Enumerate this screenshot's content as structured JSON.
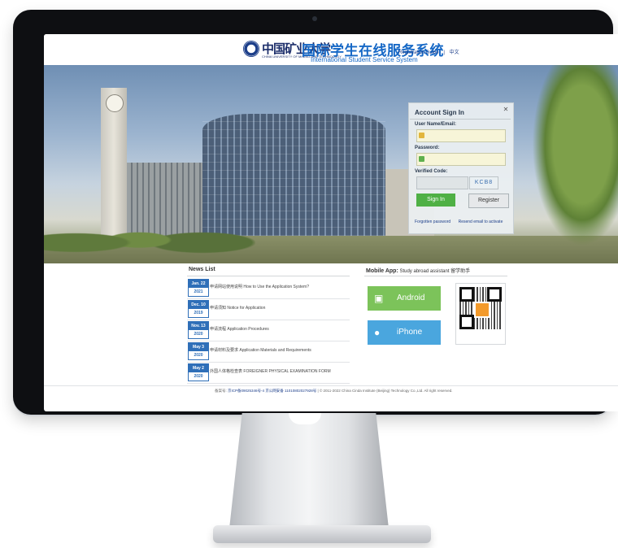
{
  "header": {
    "university_name_cn": "中国矿业大学",
    "university_name_en": "CHINA UNIVERSITY OF MINING AND TECHNOLOGY",
    "site_title_cn": "国际学生在线服务系统",
    "site_title_en": "International Student Service System",
    "links": [
      "Registration Guide",
      "|",
      "中文"
    ]
  },
  "login": {
    "title": "Account Sign In",
    "username_label": "User Name/Email:",
    "password_label": "Password:",
    "code_label": "Verified Code:",
    "code_image_text": "KCB8",
    "signin_label": "Sign In",
    "register_label": "Register",
    "forgot_label": "Forgotten password",
    "resend_label": "Resend email to activate"
  },
  "news": {
    "title": "News List",
    "items": [
      {
        "date": "Jan. 22",
        "year": "2021",
        "text": "申请网站使用说明 How to Use the Application System?"
      },
      {
        "date": "Dec. 10",
        "year": "2019",
        "text": "申请须知 Notice for Application"
      },
      {
        "date": "Nov. 13",
        "year": "2020",
        "text": "申请流程 Application Procedures"
      },
      {
        "date": "May 3",
        "year": "2020",
        "text": "申请材料及要求 Application Materials and Requirements"
      },
      {
        "date": "May 2",
        "year": "2020",
        "text": "外国人体格检查表 FOREIGNER PHYSICAL EXAMINATION FORM"
      }
    ]
  },
  "app": {
    "title": "Mobile App:",
    "subtitle": "Study abroad assistant  留学助手",
    "android_label": "Android",
    "iphone_label": "iPhone"
  },
  "footer": {
    "icp_label": "备案号:",
    "icp_number": "京ICP备09025346号-4",
    "police_number": "京公网安备 11010802027928号",
    "copyright": "© 2011-2022 China Cinda Institute (Beijing) Technology Co.,Ltd. All right reserved."
  }
}
